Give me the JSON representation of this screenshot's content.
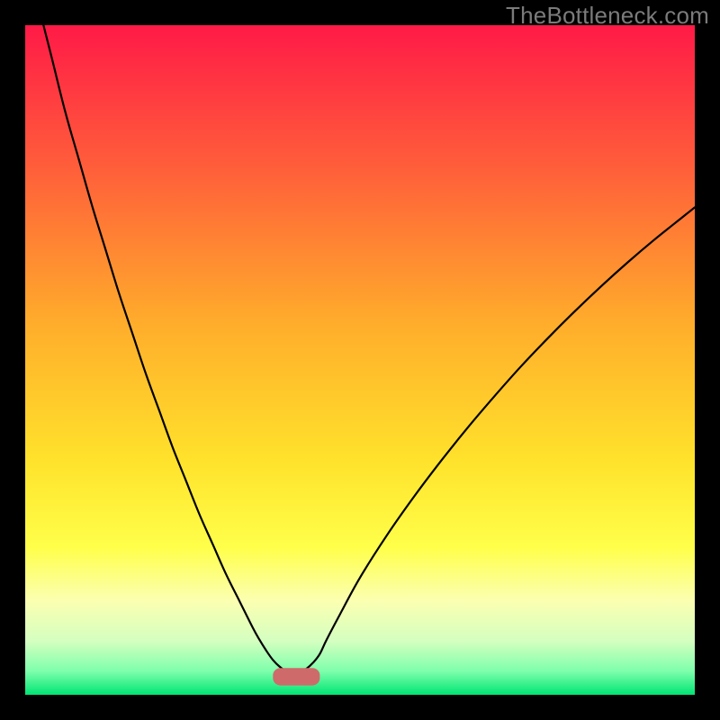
{
  "watermark": "TheBottleneck.com",
  "chart_data": {
    "type": "line",
    "title": "",
    "xlabel": "",
    "ylabel": "",
    "xlim": [
      0,
      100
    ],
    "ylim": [
      0,
      100
    ],
    "grid": false,
    "legend": false,
    "annotations": [],
    "background_gradient": {
      "stops": [
        {
          "offset": 0.0,
          "color": "#ff1a47"
        },
        {
          "offset": 0.2,
          "color": "#ff5a3b"
        },
        {
          "offset": 0.45,
          "color": "#ffae2b"
        },
        {
          "offset": 0.65,
          "color": "#ffe22b"
        },
        {
          "offset": 0.78,
          "color": "#ffff4a"
        },
        {
          "offset": 0.86,
          "color": "#fbffb1"
        },
        {
          "offset": 0.92,
          "color": "#d4ffc0"
        },
        {
          "offset": 0.965,
          "color": "#7dffab"
        },
        {
          "offset": 1.0,
          "color": "#00e574"
        }
      ]
    },
    "marker_bar": {
      "x_start": 37,
      "x_end": 44,
      "y": 2.7,
      "height": 2.6,
      "color": "#cf6a6b",
      "rx": 1.1
    },
    "series": [
      {
        "name": "curve",
        "color": "#000000",
        "width": 2.2,
        "x": [
          0,
          2,
          4,
          6,
          8,
          10,
          12,
          14,
          16,
          18,
          20,
          22,
          24,
          26,
          28,
          30,
          32,
          34,
          35,
          36,
          37,
          38,
          39,
          40,
          41,
          42,
          43,
          44,
          45,
          47,
          50,
          54,
          58,
          62,
          66,
          70,
          74,
          78,
          82,
          86,
          90,
          94,
          98,
          100
        ],
        "y": [
          112,
          103,
          95,
          87,
          80,
          73,
          66.5,
          60,
          54,
          48,
          42.5,
          37,
          32,
          27,
          22.5,
          18,
          14,
          10,
          8.2,
          6.6,
          5.2,
          4.2,
          3.5,
          3.2,
          3.4,
          3.9,
          4.8,
          6.1,
          8.2,
          12,
          17.5,
          23.8,
          29.5,
          34.8,
          39.8,
          44.5,
          49,
          53.2,
          57.2,
          61,
          64.6,
          68,
          71.2,
          72.8
        ]
      }
    ]
  }
}
